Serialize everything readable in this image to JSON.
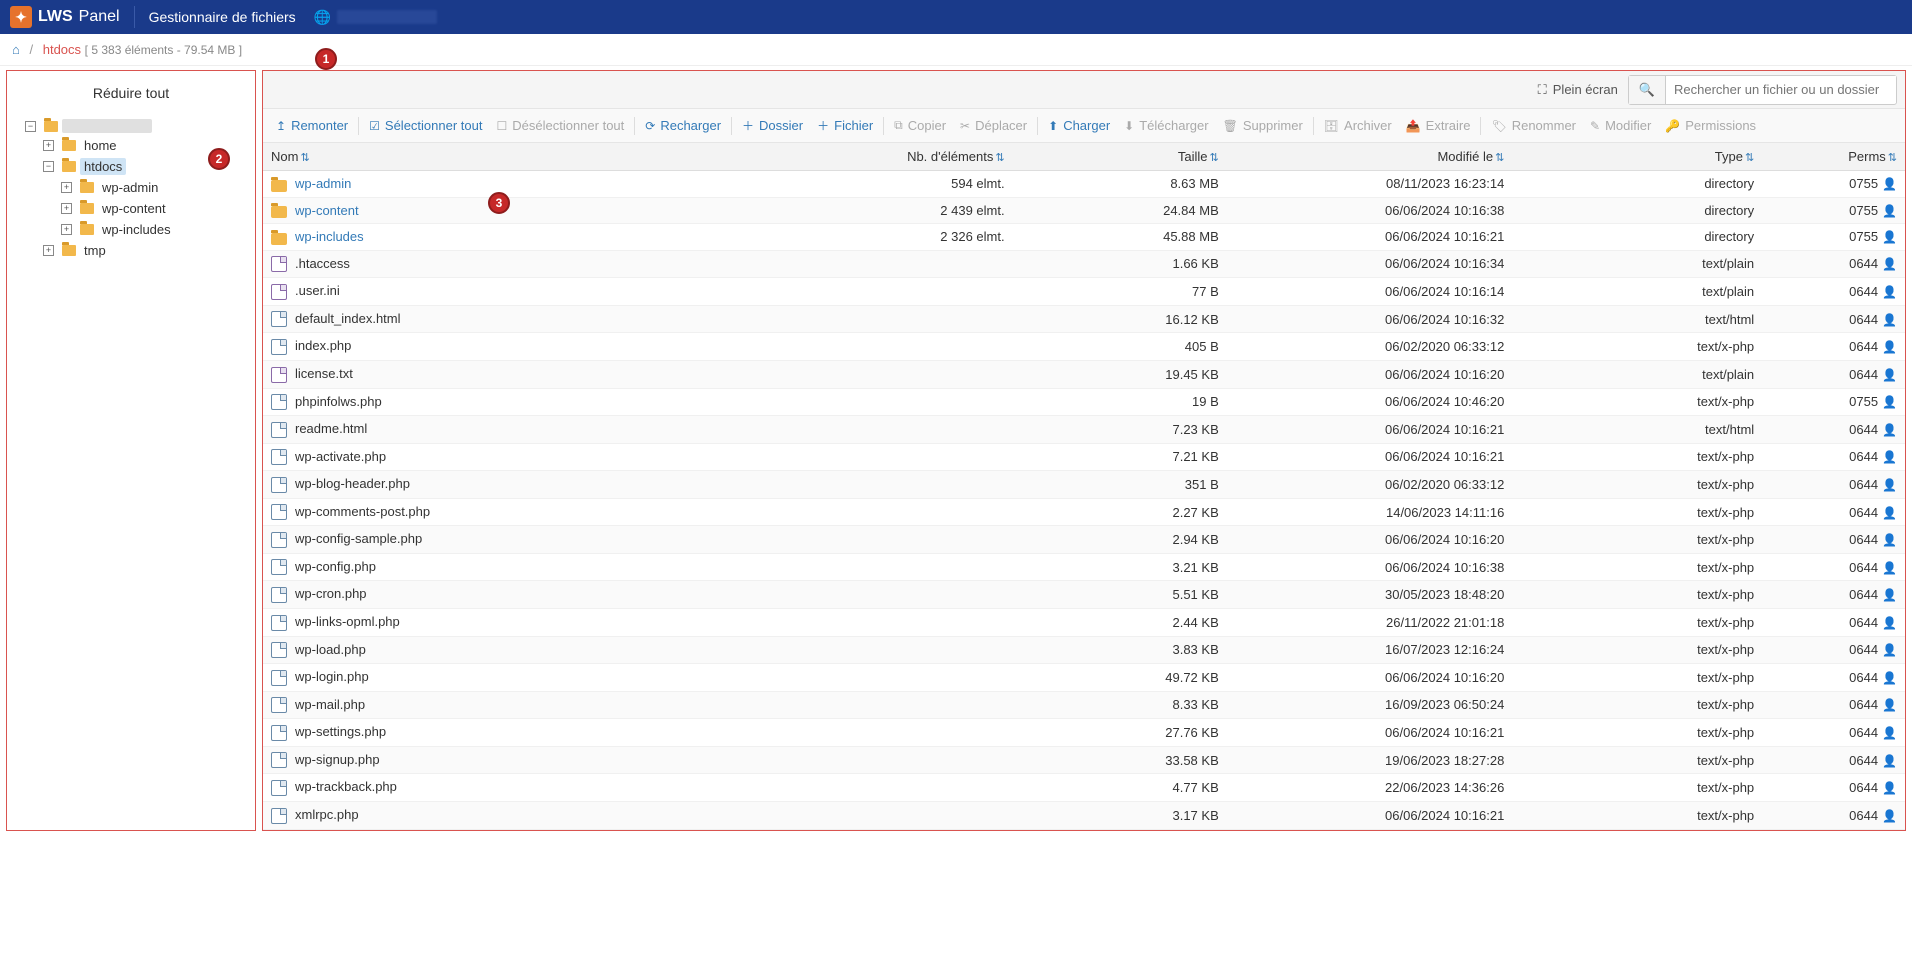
{
  "header": {
    "brand_prefix": "LWS",
    "brand_suffix": "Panel",
    "title": "Gestionnaire de fichiers"
  },
  "breadcrumb": {
    "home_icon": "⌂",
    "current": "htdocs",
    "meta": "[ 5 383 éléments - 79.54 MB ]"
  },
  "sidebar": {
    "collapse_all": "Réduire tout",
    "tree": {
      "root": "",
      "home": "home",
      "htdocs": "htdocs",
      "wp_admin": "wp-admin",
      "wp_content": "wp-content",
      "wp_includes": "wp-includes",
      "tmp": "tmp"
    }
  },
  "callouts": {
    "one": "1",
    "two": "2",
    "three": "3"
  },
  "controls": {
    "fullscreen": "Plein écran",
    "search_placeholder": "Rechercher un fichier ou un dossier"
  },
  "toolbar": {
    "up": "Remonter",
    "select_all": "Sélectionner tout",
    "deselect_all": "Désélectionner tout",
    "reload": "Recharger",
    "new_folder": "Dossier",
    "new_file": "Fichier",
    "copy": "Copier",
    "move": "Déplacer",
    "upload": "Charger",
    "download": "Télécharger",
    "delete": "Supprimer",
    "archive": "Archiver",
    "extract": "Extraire",
    "rename": "Renommer",
    "edit": "Modifier",
    "permissions": "Permissions"
  },
  "columns": {
    "name": "Nom",
    "elements": "Nb. d'éléments",
    "size": "Taille",
    "modified": "Modifié le",
    "type": "Type",
    "perms": "Perms"
  },
  "rows": [
    {
      "icon": "folder",
      "name": "wp-admin",
      "link": true,
      "elements": "594 elmt.",
      "size": "8.63 MB",
      "modified": "08/11/2023 16:23:14",
      "type": "directory",
      "perms": "0755"
    },
    {
      "icon": "folder",
      "name": "wp-content",
      "link": true,
      "elements": "2 439 elmt.",
      "size": "24.84 MB",
      "modified": "06/06/2024 10:16:38",
      "type": "directory",
      "perms": "0755"
    },
    {
      "icon": "folder",
      "name": "wp-includes",
      "link": true,
      "elements": "2 326 elmt.",
      "size": "45.88 MB",
      "modified": "06/06/2024 10:16:21",
      "type": "directory",
      "perms": "0755"
    },
    {
      "icon": "file",
      "name": ".htaccess",
      "link": false,
      "elements": "",
      "size": "1.66 KB",
      "modified": "06/06/2024 10:16:34",
      "type": "text/plain",
      "perms": "0644"
    },
    {
      "icon": "file",
      "name": ".user.ini",
      "link": false,
      "elements": "",
      "size": "77 B",
      "modified": "06/06/2024 10:16:14",
      "type": "text/plain",
      "perms": "0644"
    },
    {
      "icon": "code",
      "name": "default_index.html",
      "link": false,
      "elements": "",
      "size": "16.12 KB",
      "modified": "06/06/2024 10:16:32",
      "type": "text/html",
      "perms": "0644"
    },
    {
      "icon": "code",
      "name": "index.php",
      "link": false,
      "elements": "",
      "size": "405 B",
      "modified": "06/02/2020 06:33:12",
      "type": "text/x-php",
      "perms": "0644"
    },
    {
      "icon": "file",
      "name": "license.txt",
      "link": false,
      "elements": "",
      "size": "19.45 KB",
      "modified": "06/06/2024 10:16:20",
      "type": "text/plain",
      "perms": "0644"
    },
    {
      "icon": "code",
      "name": "phpinfolws.php",
      "link": false,
      "elements": "",
      "size": "19 B",
      "modified": "06/06/2024 10:46:20",
      "type": "text/x-php",
      "perms": "0755"
    },
    {
      "icon": "code",
      "name": "readme.html",
      "link": false,
      "elements": "",
      "size": "7.23 KB",
      "modified": "06/06/2024 10:16:21",
      "type": "text/html",
      "perms": "0644"
    },
    {
      "icon": "code",
      "name": "wp-activate.php",
      "link": false,
      "elements": "",
      "size": "7.21 KB",
      "modified": "06/06/2024 10:16:21",
      "type": "text/x-php",
      "perms": "0644"
    },
    {
      "icon": "code",
      "name": "wp-blog-header.php",
      "link": false,
      "elements": "",
      "size": "351 B",
      "modified": "06/02/2020 06:33:12",
      "type": "text/x-php",
      "perms": "0644"
    },
    {
      "icon": "code",
      "name": "wp-comments-post.php",
      "link": false,
      "elements": "",
      "size": "2.27 KB",
      "modified": "14/06/2023 14:11:16",
      "type": "text/x-php",
      "perms": "0644"
    },
    {
      "icon": "code",
      "name": "wp-config-sample.php",
      "link": false,
      "elements": "",
      "size": "2.94 KB",
      "modified": "06/06/2024 10:16:20",
      "type": "text/x-php",
      "perms": "0644"
    },
    {
      "icon": "code",
      "name": "wp-config.php",
      "link": false,
      "elements": "",
      "size": "3.21 KB",
      "modified": "06/06/2024 10:16:38",
      "type": "text/x-php",
      "perms": "0644"
    },
    {
      "icon": "code",
      "name": "wp-cron.php",
      "link": false,
      "elements": "",
      "size": "5.51 KB",
      "modified": "30/05/2023 18:48:20",
      "type": "text/x-php",
      "perms": "0644"
    },
    {
      "icon": "code",
      "name": "wp-links-opml.php",
      "link": false,
      "elements": "",
      "size": "2.44 KB",
      "modified": "26/11/2022 21:01:18",
      "type": "text/x-php",
      "perms": "0644"
    },
    {
      "icon": "code",
      "name": "wp-load.php",
      "link": false,
      "elements": "",
      "size": "3.83 KB",
      "modified": "16/07/2023 12:16:24",
      "type": "text/x-php",
      "perms": "0644"
    },
    {
      "icon": "code",
      "name": "wp-login.php",
      "link": false,
      "elements": "",
      "size": "49.72 KB",
      "modified": "06/06/2024 10:16:20",
      "type": "text/x-php",
      "perms": "0644"
    },
    {
      "icon": "code",
      "name": "wp-mail.php",
      "link": false,
      "elements": "",
      "size": "8.33 KB",
      "modified": "16/09/2023 06:50:24",
      "type": "text/x-php",
      "perms": "0644"
    },
    {
      "icon": "code",
      "name": "wp-settings.php",
      "link": false,
      "elements": "",
      "size": "27.76 KB",
      "modified": "06/06/2024 10:16:21",
      "type": "text/x-php",
      "perms": "0644"
    },
    {
      "icon": "code",
      "name": "wp-signup.php",
      "link": false,
      "elements": "",
      "size": "33.58 KB",
      "modified": "19/06/2023 18:27:28",
      "type": "text/x-php",
      "perms": "0644"
    },
    {
      "icon": "code",
      "name": "wp-trackback.php",
      "link": false,
      "elements": "",
      "size": "4.77 KB",
      "modified": "22/06/2023 14:36:26",
      "type": "text/x-php",
      "perms": "0644"
    },
    {
      "icon": "code",
      "name": "xmlrpc.php",
      "link": false,
      "elements": "",
      "size": "3.17 KB",
      "modified": "06/06/2024 10:16:21",
      "type": "text/x-php",
      "perms": "0644"
    }
  ]
}
